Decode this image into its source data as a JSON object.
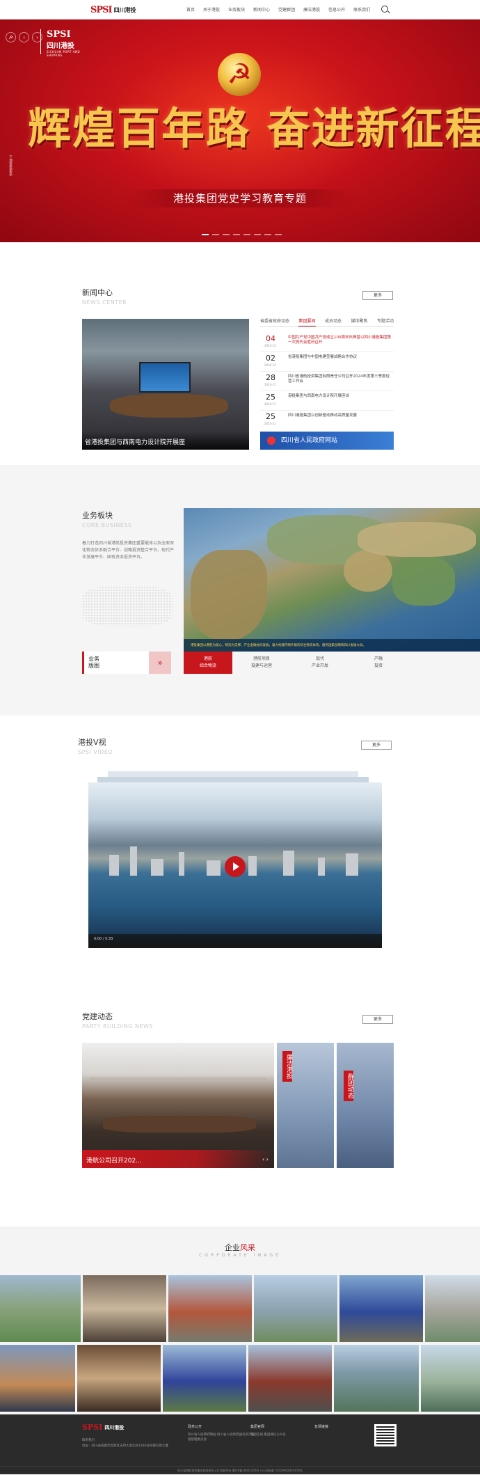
{
  "header": {
    "brand_mark": "SPSI",
    "brand_name": "四川港投",
    "menu": [
      "首页",
      "关于港投",
      "业务板块",
      "新闻中心",
      "党建群团",
      "廉洁港投",
      "信息公开",
      "联系我们"
    ]
  },
  "banner": {
    "logo_mark": "SPSI",
    "logo_name": "四川港投",
    "logo_sub": "SICHUAN PORT AND SHIPPING",
    "slogan": "辉煌百年路 奋进新征程",
    "subtitle": "港投集团党史学习教育专题",
    "side_text": "下滑查看更多"
  },
  "news": {
    "title": "新闻中心",
    "title_en": "NEWS CENTER",
    "more": "更多",
    "feature_caption": "省港投集团与西南电力设计院开展座",
    "tabs": [
      "省委省政府动态",
      "集团要闻",
      "成员动态",
      "媒体聚焦",
      "专题活动"
    ],
    "active_tab": 1,
    "items": [
      {
        "day": "04",
        "ym": "2024-12",
        "text": "中国共产党中国共产党成立100周年庆典暨以四川港投集团第一次党代会胜利召开"
      },
      {
        "day": "02",
        "ym": "2024-12",
        "text": "省港投集团与中国电建签署战略合作协议"
      },
      {
        "day": "28",
        "ym": "2024-11",
        "text": "四川省港航投资集团有限责任公司召开2024年度第三季度经营工作会"
      },
      {
        "day": "25",
        "ym": "2024-11",
        "text": "港投集团与西南电力设计院开展座谈"
      },
      {
        "day": "25",
        "ym": "2024-11",
        "text": "四川港投集团以创新驱动推动高质量发展"
      }
    ],
    "gov_banner": "四川省人民政府网站"
  },
  "business": {
    "title": "业务板块",
    "title_en": "CORE BUSINESS",
    "desc": "着力打造四川省港航投资集团重要载体以及全面深化物流体系融合平台、战略投资整合平台、现代产业发展平台、国有资本投资平台。",
    "map_caption": "港投集团以港航为核心，物流为支撑，产业金融协同发展，着力构建内畅外联的综合物流体系，服务国家战略和四川发展大局。",
    "home_label": "业务\n版图",
    "home_arrow": "»",
    "tabs": [
      "港航\n综合物流",
      "港航项目\n投建与运营",
      "现代\n产业开发",
      "产融\n投资"
    ],
    "active_tab": 0
  },
  "video": {
    "title": "港投V视",
    "title_en": "SPSI VIDEO",
    "more": "更多",
    "time": "0:00 / 5:33"
  },
  "party": {
    "title": "党建动态",
    "title_en": "PARTY BUILDING NEWS",
    "more": "更多",
    "feature_caption": "港航公司召开202...",
    "nav": "‹ ›",
    "cards": [
      "廉洁港投",
      "群团动态"
    ]
  },
  "corporate": {
    "title_prefix": "企业",
    "title_red": "风采",
    "title_en": "CORPORATE IMAGE"
  },
  "footer": {
    "brand_mark": "SPSI",
    "brand_name": "四川港投",
    "address_label": "联系我们",
    "address": "地址：四川省成都市高新区天府大道北段1480号拉德方斯大厦",
    "col1_title": "政务公开",
    "col1_links": "四川省人民政府网站  四川省人民政府国有资产监督管理委员会",
    "col2_title": "集团官网",
    "col2_links": "集团在线  集团微信公众号",
    "col3_title": "友情链接",
    "copyright": "四川省港航投资集团有限责任公司 版权所有  蜀ICP备19001476号  川公网安备 51019002001478号"
  },
  "colors": {
    "brand_red": "#c8161d",
    "banner_red": "#c4111a",
    "gold": "#f6c64e",
    "footer_bg": "#2b2b2b"
  }
}
